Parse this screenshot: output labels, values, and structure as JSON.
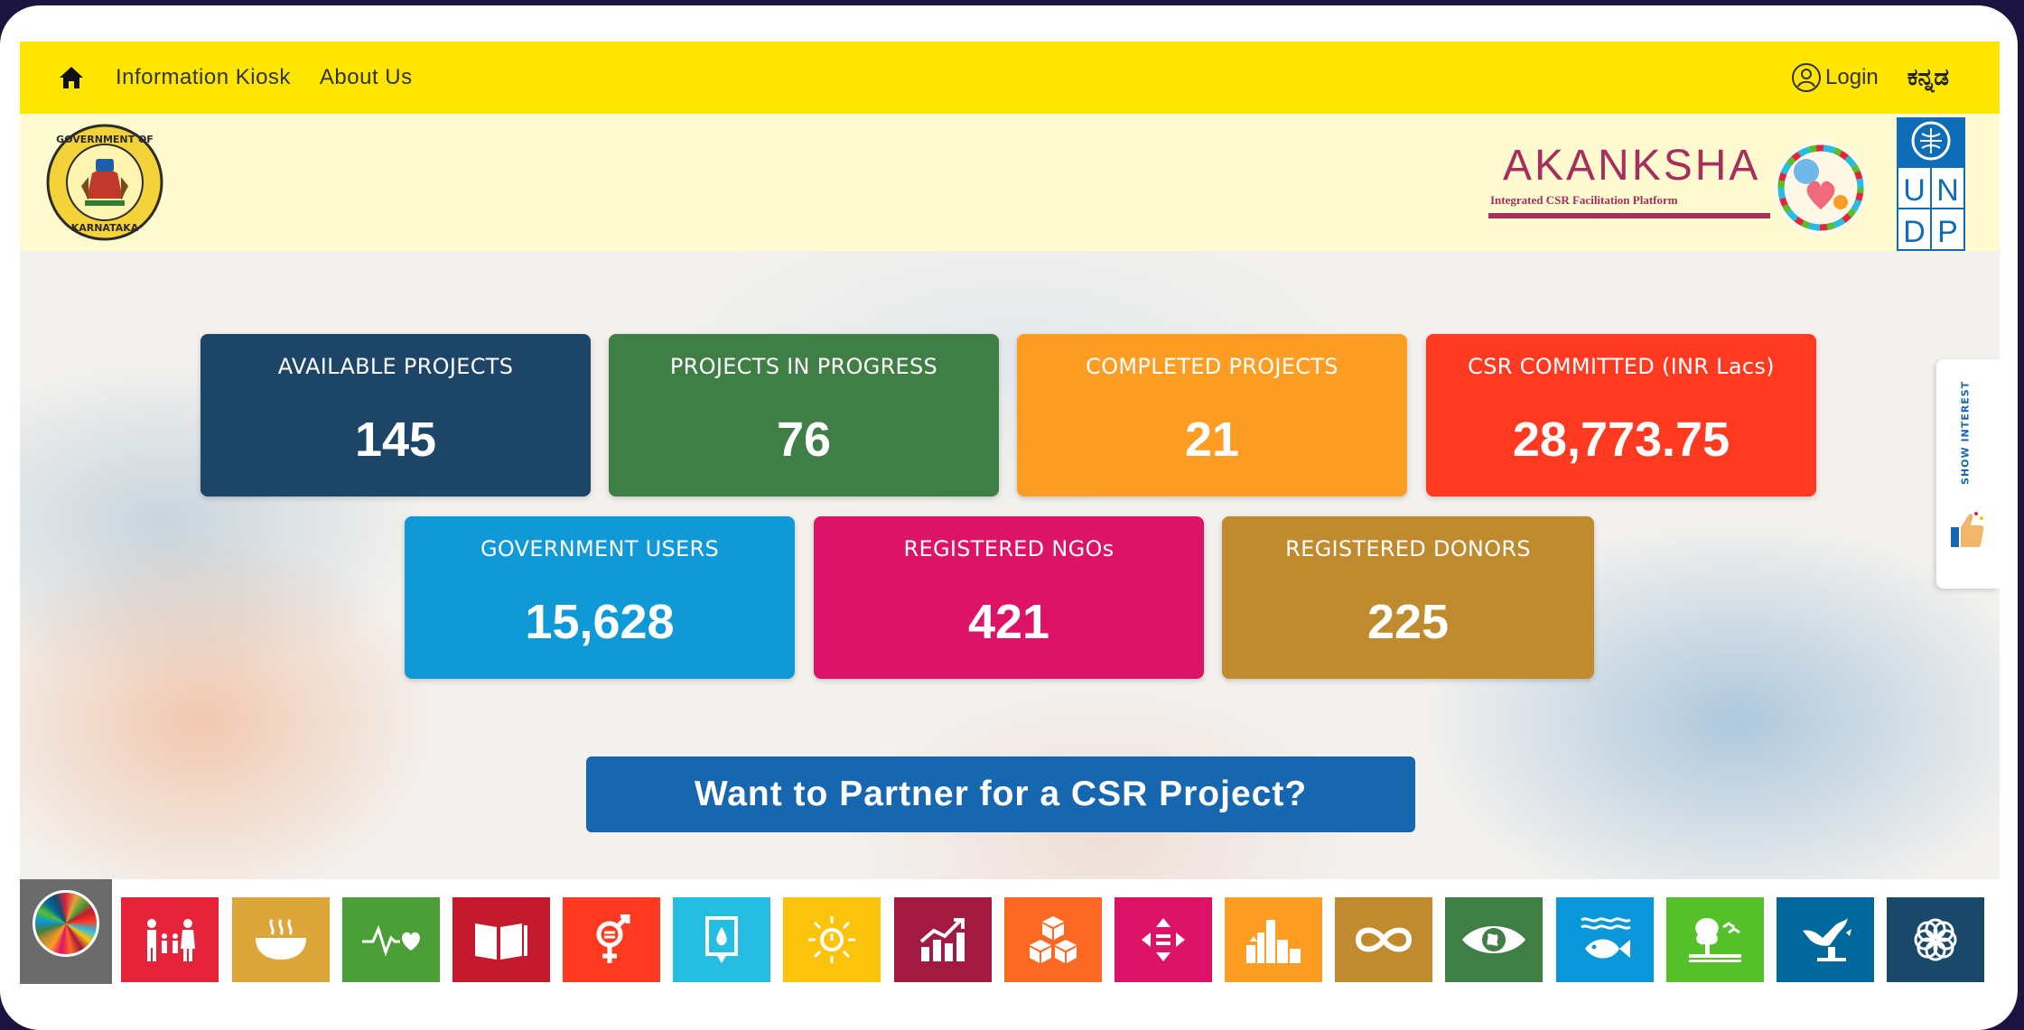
{
  "topnav": {
    "home_icon": "home-icon",
    "links": [
      "Information Kiosk",
      "About Us"
    ],
    "login_label": "Login",
    "language_label": "ಕನ್ನಡ"
  },
  "header": {
    "emblem_text_top": "GOVERNMENT OF",
    "emblem_text_bottom": "KARNATAKA",
    "brand_title": "AKANKSHA",
    "brand_subtitle": "Integrated CSR Facilitation Platform",
    "partner_logo_letters": [
      "U",
      "N",
      "D",
      "P"
    ]
  },
  "stats": [
    {
      "label": "AVAILABLE PROJECTS",
      "value": "145",
      "color": "#1c4568"
    },
    {
      "label": "PROJECTS IN PROGRESS",
      "value": "76",
      "color": "#3f7e44"
    },
    {
      "label": "COMPLETED PROJECTS",
      "value": "21",
      "color": "#fd9d24"
    },
    {
      "label": "CSR COMMITTED (INR Lacs)",
      "value": "28,773.75",
      "color": "#ff3a21"
    },
    {
      "label": "GOVERNMENT USERS",
      "value": "15,628",
      "color": "#0f99d6"
    },
    {
      "label": "REGISTERED NGOs",
      "value": "421",
      "color": "#dd1367"
    },
    {
      "label": "REGISTERED DONORS",
      "value": "225",
      "color": "#bf8b2e"
    }
  ],
  "cta_label": "Want to Partner for a CSR Project?",
  "side_tab": {
    "label": "SHOW INTEREST",
    "icon": "thumbs-up-icon"
  },
  "sdg_goals": [
    {
      "icon": "family-icon",
      "color": "#e5243b"
    },
    {
      "icon": "food-bowl-icon",
      "color": "#dda63a"
    },
    {
      "icon": "heartbeat-icon",
      "color": "#4c9f38"
    },
    {
      "icon": "book-icon",
      "color": "#c5192d"
    },
    {
      "icon": "gender-icon",
      "color": "#ff3a21"
    },
    {
      "icon": "water-drop-icon",
      "color": "#26bde2"
    },
    {
      "icon": "sun-power-icon",
      "color": "#fcc30b"
    },
    {
      "icon": "growth-chart-icon",
      "color": "#a21942"
    },
    {
      "icon": "cubes-icon",
      "color": "#fd6925"
    },
    {
      "icon": "equality-arrows-icon",
      "color": "#dd1367"
    },
    {
      "icon": "city-icon",
      "color": "#fd9d24"
    },
    {
      "icon": "infinity-icon",
      "color": "#bf8b2e"
    },
    {
      "icon": "eye-earth-icon",
      "color": "#3f7e44"
    },
    {
      "icon": "fish-icon",
      "color": "#0a97d9"
    },
    {
      "icon": "tree-icon",
      "color": "#56c02b"
    },
    {
      "icon": "dove-icon",
      "color": "#00689d"
    },
    {
      "icon": "partnership-flower-icon",
      "color": "#19486a"
    }
  ]
}
